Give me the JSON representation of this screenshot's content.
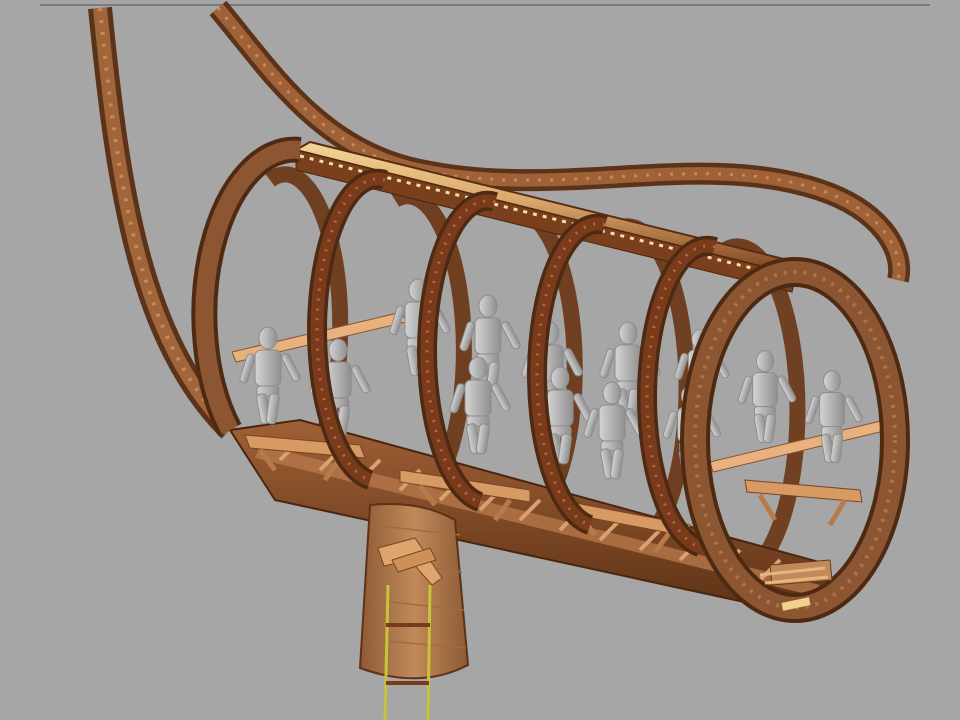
{
  "scene": {
    "background": "#a6a6a6",
    "top_rule_color": "#7c7c7c",
    "colors": {
      "wood_dark": "#5e3417",
      "wood_mid": "#8a5230",
      "wood_ring": "#7a3b1c",
      "wood_light": "#d99b66",
      "plank_light": "#e9b989",
      "top_beam_light": "#f1d18e",
      "figure": "#b9b9b9",
      "figure_shade": "#8c8c8c",
      "rope": "#c9c33a"
    },
    "rings": 6,
    "seated_figures": 13,
    "icons": {
      "figure": "wooden-mannequin-icon",
      "ring": "wooden-hoop-icon"
    }
  }
}
